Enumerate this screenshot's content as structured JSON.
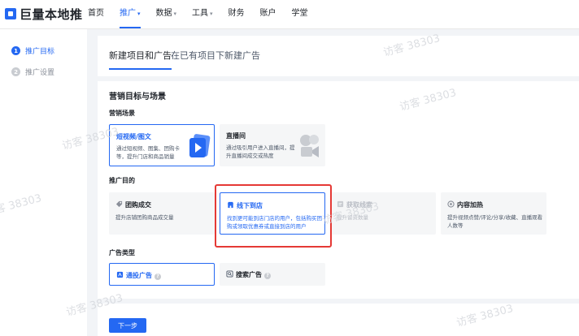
{
  "app": {
    "logo_text": "巨量本地推",
    "brand_color": "#2468f2"
  },
  "nav": {
    "items": [
      {
        "label": "首页",
        "has_caret": false,
        "active": false
      },
      {
        "label": "推广",
        "has_caret": true,
        "active": true
      },
      {
        "label": "数据",
        "has_caret": true,
        "active": false
      },
      {
        "label": "工具",
        "has_caret": true,
        "active": false
      },
      {
        "label": "财务",
        "has_caret": false,
        "active": false
      },
      {
        "label": "账户",
        "has_caret": false,
        "active": false
      },
      {
        "label": "学堂",
        "has_caret": false,
        "active": false
      }
    ],
    "caret": "▾"
  },
  "sidebar": {
    "steps": [
      {
        "num": "1",
        "label": "推广目标",
        "active": true
      },
      {
        "num": "2",
        "label": "推广设置",
        "active": false
      }
    ]
  },
  "tabs": [
    {
      "label": "新建项目和广告",
      "active": true
    },
    {
      "label": "在已有项目下新建广告",
      "active": false
    }
  ],
  "main": {
    "section_title": "营销目标与场景",
    "scene_title": "营销场景",
    "scenes": [
      {
        "title": "短视频/图文",
        "desc": "通过短视频、图集、团购卡等，提升门店和商品销量",
        "selected": true
      },
      {
        "title": "直播间",
        "desc": "通过吸引用户进入直播间，提升直播间成交或热度",
        "selected": false
      }
    ],
    "goal_title": "推广目的",
    "goals": [
      {
        "title": "团购成交",
        "desc": "提升店铺团购商品成交量",
        "icon": "tag-icon",
        "selected": false,
        "disabled": false
      },
      {
        "title": "线下到店",
        "desc": "找到更可能到店门店的用户，包括购买团购或领取优惠券或直接到店的用户",
        "icon": "store-icon",
        "selected": true,
        "disabled": false
      },
      {
        "title": "获取线索",
        "desc": "提升留资数量",
        "icon": "lead-icon",
        "selected": false,
        "disabled": true
      },
      {
        "title": "内容加热",
        "desc": "提升视频点赞/评论/分享/收藏、直播观看人数等",
        "icon": "flame-icon",
        "selected": false,
        "disabled": false
      }
    ],
    "adtype_title": "广告类型",
    "adtypes": [
      {
        "title": "通投广告",
        "icon": "broadcast-icon",
        "selected": true
      },
      {
        "title": "搜索广告",
        "icon": "search-ad-icon",
        "selected": false
      }
    ],
    "help_glyph": "?"
  },
  "footer": {
    "next_label": "下一步"
  },
  "watermark": {
    "text": "访客 38303"
  }
}
